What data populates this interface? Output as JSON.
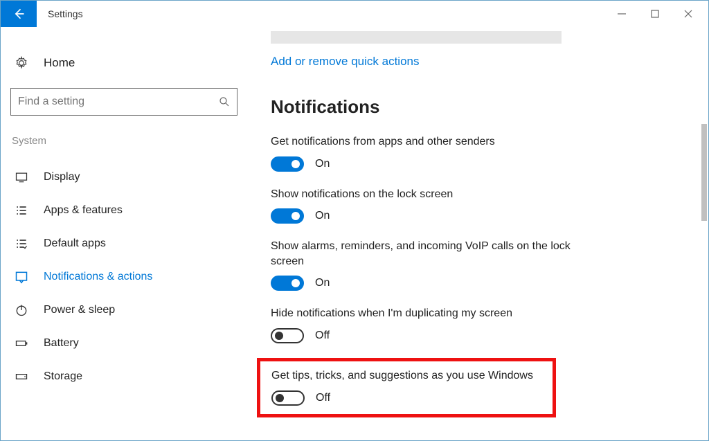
{
  "window": {
    "title": "Settings"
  },
  "sidebar": {
    "home": "Home",
    "search_placeholder": "Find a setting",
    "section": "System",
    "items": [
      {
        "label": "Display"
      },
      {
        "label": "Apps & features"
      },
      {
        "label": "Default apps"
      },
      {
        "label": "Notifications & actions"
      },
      {
        "label": "Power & sleep"
      },
      {
        "label": "Battery"
      },
      {
        "label": "Storage"
      }
    ]
  },
  "main": {
    "quick_link": "Add or remove quick actions",
    "heading": "Notifications",
    "settings": [
      {
        "desc": "Get notifications from apps and other senders",
        "state": "On",
        "on": true
      },
      {
        "desc": "Show notifications on the lock screen",
        "state": "On",
        "on": true
      },
      {
        "desc": "Show alarms, reminders, and incoming VoIP calls on the lock screen",
        "state": "On",
        "on": true
      },
      {
        "desc": "Hide notifications when I'm duplicating my screen",
        "state": "Off",
        "on": false
      },
      {
        "desc": "Get tips, tricks, and suggestions as you use Windows",
        "state": "Off",
        "on": false
      }
    ]
  }
}
